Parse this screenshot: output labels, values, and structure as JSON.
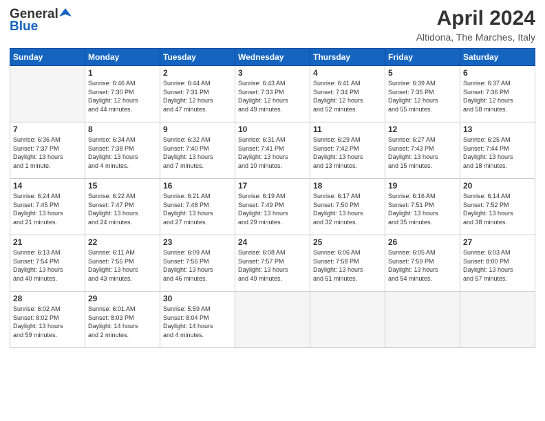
{
  "header": {
    "logo_general": "General",
    "logo_blue": "Blue",
    "month_title": "April 2024",
    "location": "Altidona, The Marches, Italy"
  },
  "days_of_week": [
    "Sunday",
    "Monday",
    "Tuesday",
    "Wednesday",
    "Thursday",
    "Friday",
    "Saturday"
  ],
  "weeks": [
    [
      {
        "day": "",
        "info": ""
      },
      {
        "day": "1",
        "info": "Sunrise: 6:46 AM\nSunset: 7:30 PM\nDaylight: 12 hours\nand 44 minutes."
      },
      {
        "day": "2",
        "info": "Sunrise: 6:44 AM\nSunset: 7:31 PM\nDaylight: 12 hours\nand 47 minutes."
      },
      {
        "day": "3",
        "info": "Sunrise: 6:43 AM\nSunset: 7:33 PM\nDaylight: 12 hours\nand 49 minutes."
      },
      {
        "day": "4",
        "info": "Sunrise: 6:41 AM\nSunset: 7:34 PM\nDaylight: 12 hours\nand 52 minutes."
      },
      {
        "day": "5",
        "info": "Sunrise: 6:39 AM\nSunset: 7:35 PM\nDaylight: 12 hours\nand 55 minutes."
      },
      {
        "day": "6",
        "info": "Sunrise: 6:37 AM\nSunset: 7:36 PM\nDaylight: 12 hours\nand 58 minutes."
      }
    ],
    [
      {
        "day": "7",
        "info": "Sunrise: 6:36 AM\nSunset: 7:37 PM\nDaylight: 13 hours\nand 1 minute."
      },
      {
        "day": "8",
        "info": "Sunrise: 6:34 AM\nSunset: 7:38 PM\nDaylight: 13 hours\nand 4 minutes."
      },
      {
        "day": "9",
        "info": "Sunrise: 6:32 AM\nSunset: 7:40 PM\nDaylight: 13 hours\nand 7 minutes."
      },
      {
        "day": "10",
        "info": "Sunrise: 6:31 AM\nSunset: 7:41 PM\nDaylight: 13 hours\nand 10 minutes."
      },
      {
        "day": "11",
        "info": "Sunrise: 6:29 AM\nSunset: 7:42 PM\nDaylight: 13 hours\nand 13 minutes."
      },
      {
        "day": "12",
        "info": "Sunrise: 6:27 AM\nSunset: 7:43 PM\nDaylight: 13 hours\nand 15 minutes."
      },
      {
        "day": "13",
        "info": "Sunrise: 6:25 AM\nSunset: 7:44 PM\nDaylight: 13 hours\nand 18 minutes."
      }
    ],
    [
      {
        "day": "14",
        "info": "Sunrise: 6:24 AM\nSunset: 7:45 PM\nDaylight: 13 hours\nand 21 minutes."
      },
      {
        "day": "15",
        "info": "Sunrise: 6:22 AM\nSunset: 7:47 PM\nDaylight: 13 hours\nand 24 minutes."
      },
      {
        "day": "16",
        "info": "Sunrise: 6:21 AM\nSunset: 7:48 PM\nDaylight: 13 hours\nand 27 minutes."
      },
      {
        "day": "17",
        "info": "Sunrise: 6:19 AM\nSunset: 7:49 PM\nDaylight: 13 hours\nand 29 minutes."
      },
      {
        "day": "18",
        "info": "Sunrise: 6:17 AM\nSunset: 7:50 PM\nDaylight: 13 hours\nand 32 minutes."
      },
      {
        "day": "19",
        "info": "Sunrise: 6:16 AM\nSunset: 7:51 PM\nDaylight: 13 hours\nand 35 minutes."
      },
      {
        "day": "20",
        "info": "Sunrise: 6:14 AM\nSunset: 7:52 PM\nDaylight: 13 hours\nand 38 minutes."
      }
    ],
    [
      {
        "day": "21",
        "info": "Sunrise: 6:13 AM\nSunset: 7:54 PM\nDaylight: 13 hours\nand 40 minutes."
      },
      {
        "day": "22",
        "info": "Sunrise: 6:11 AM\nSunset: 7:55 PM\nDaylight: 13 hours\nand 43 minutes."
      },
      {
        "day": "23",
        "info": "Sunrise: 6:09 AM\nSunset: 7:56 PM\nDaylight: 13 hours\nand 46 minutes."
      },
      {
        "day": "24",
        "info": "Sunrise: 6:08 AM\nSunset: 7:57 PM\nDaylight: 13 hours\nand 49 minutes."
      },
      {
        "day": "25",
        "info": "Sunrise: 6:06 AM\nSunset: 7:58 PM\nDaylight: 13 hours\nand 51 minutes."
      },
      {
        "day": "26",
        "info": "Sunrise: 6:05 AM\nSunset: 7:59 PM\nDaylight: 13 hours\nand 54 minutes."
      },
      {
        "day": "27",
        "info": "Sunrise: 6:03 AM\nSunset: 8:00 PM\nDaylight: 13 hours\nand 57 minutes."
      }
    ],
    [
      {
        "day": "28",
        "info": "Sunrise: 6:02 AM\nSunset: 8:02 PM\nDaylight: 13 hours\nand 59 minutes."
      },
      {
        "day": "29",
        "info": "Sunrise: 6:01 AM\nSunset: 8:03 PM\nDaylight: 14 hours\nand 2 minutes."
      },
      {
        "day": "30",
        "info": "Sunrise: 5:59 AM\nSunset: 8:04 PM\nDaylight: 14 hours\nand 4 minutes."
      },
      {
        "day": "",
        "info": ""
      },
      {
        "day": "",
        "info": ""
      },
      {
        "day": "",
        "info": ""
      },
      {
        "day": "",
        "info": ""
      }
    ]
  ]
}
